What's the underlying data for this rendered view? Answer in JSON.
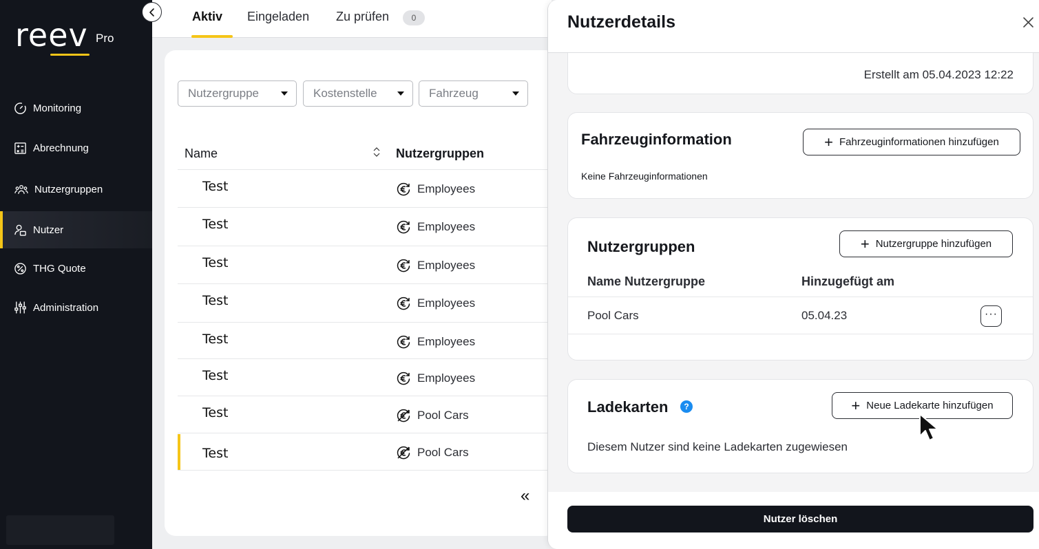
{
  "brand": {
    "logo_text": "reev",
    "edition": "Pro"
  },
  "sidebar": {
    "items": [
      {
        "label": "Monitoring",
        "icon": "gauge-icon"
      },
      {
        "label": "Abrechnung",
        "icon": "calculator-icon"
      },
      {
        "label": "Nutzergruppen",
        "icon": "users-group-icon"
      },
      {
        "label": "Nutzer",
        "icon": "user-icon",
        "active": true
      },
      {
        "label": "THG Quote",
        "icon": "percent-icon"
      },
      {
        "label": "Administration",
        "icon": "sliders-icon"
      }
    ]
  },
  "tabs": [
    {
      "label": "Aktiv",
      "active": true
    },
    {
      "label": "Eingeladen"
    },
    {
      "label": "Zu prüfen",
      "badge": "0"
    }
  ],
  "filters": [
    {
      "placeholder": "Nutzergruppe"
    },
    {
      "placeholder": "Kostenstelle"
    },
    {
      "placeholder": "Fahrzeug"
    }
  ],
  "table": {
    "columns": [
      "Name",
      "Nutzergruppen"
    ],
    "rows": [
      {
        "name": "Test",
        "group": "Employees",
        "group_icon": "euro-refresh-icon"
      },
      {
        "name": "Test",
        "group": "Employees",
        "group_icon": "euro-refresh-icon"
      },
      {
        "name": "Test",
        "group": "Employees",
        "group_icon": "euro-refresh-icon"
      },
      {
        "name": "Test",
        "group": "Employees",
        "group_icon": "euro-refresh-icon"
      },
      {
        "name": "Test",
        "group": "Employees",
        "group_icon": "euro-refresh-icon"
      },
      {
        "name": "Test",
        "group": "Employees",
        "group_icon": "euro-refresh-icon"
      },
      {
        "name": "Test",
        "group": "Pool Cars",
        "group_icon": "euro-crossed-icon"
      },
      {
        "name": "Test",
        "group": "Pool Cars",
        "group_icon": "euro-crossed-icon",
        "selected": true
      }
    ],
    "pager_first": "«"
  },
  "drawer": {
    "title": "Nutzerdetails",
    "created": "Erstellt am 05.04.2023 12:22",
    "vehicle": {
      "title": "Fahrzeuginformation",
      "add_button": "Fahrzeuginformationen hinzufügen",
      "empty": "Keine Fahrzeuginformationen"
    },
    "groups": {
      "title": "Nutzergruppen",
      "add_button": "Nutzergruppe hinzufügen",
      "col_name": "Name Nutzergruppe",
      "col_added": "Hinzugefügt am",
      "rows": [
        {
          "name": "Pool Cars",
          "added": "05.04.23"
        }
      ]
    },
    "cards": {
      "title": "Ladekarten",
      "help": "?",
      "add_button": "Neue Ladekarte hinzufügen",
      "empty": "Diesem Nutzer sind keine Ladekarten zugewiesen"
    },
    "delete_button": "Nutzer löschen"
  },
  "colors": {
    "accent": "#f5c518",
    "sidebar": "#12151c",
    "help": "#1a8cf0"
  }
}
